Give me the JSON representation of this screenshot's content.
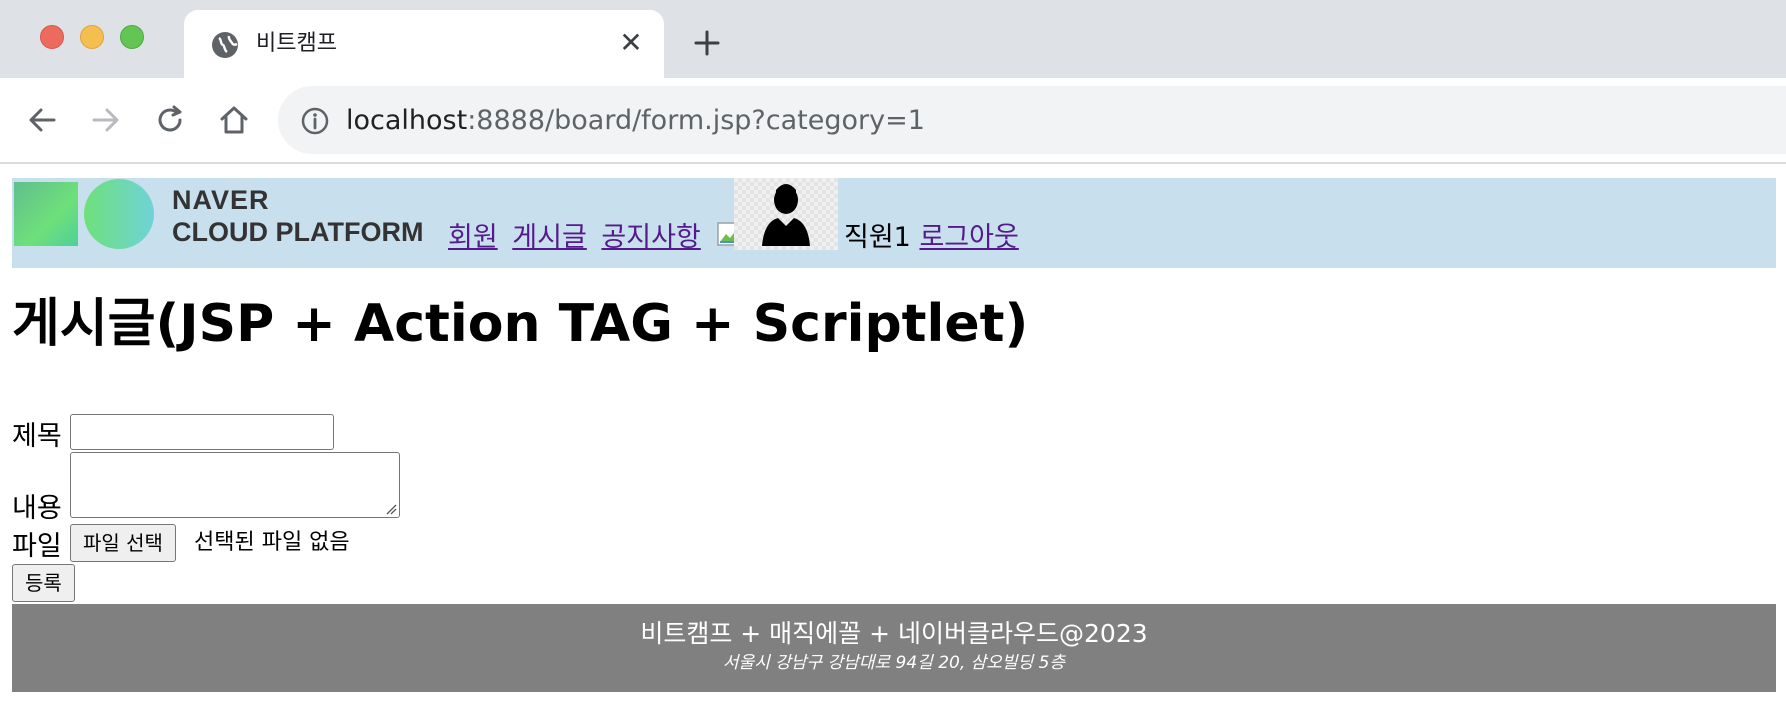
{
  "browser": {
    "tab": {
      "title": "비트캠프",
      "favicon": "globe-icon",
      "close_glyph": "✕"
    },
    "new_tab_icon": "plus-icon",
    "nav": {
      "back_icon": "arrow-left-icon",
      "forward_icon": "arrow-right-icon",
      "reload_icon": "reload-icon",
      "home_icon": "home-icon"
    },
    "address": {
      "host": "localhost",
      "rest": ":8888/board/form.jsp?category=1",
      "info_icon": "info-icon"
    },
    "window_controls": [
      "close",
      "minimize",
      "zoom"
    ]
  },
  "header": {
    "logo": {
      "line1": "NAVER",
      "line2": "CLOUD PLATFORM"
    },
    "links": [
      {
        "label": "회원"
      },
      {
        "label": "게시글"
      },
      {
        "label": "공지사항"
      }
    ],
    "user": {
      "name": "직원1",
      "logout_label": "로그아웃"
    }
  },
  "main": {
    "title": "게시글(JSP + Action TAG + Scriptlet)",
    "form": {
      "title_label": "제목",
      "title_value": "",
      "content_label": "내용",
      "content_value": "",
      "file_label": "파일",
      "file_button_label": "파일 선택",
      "file_status": "선택된 파일 없음",
      "submit_label": "등록"
    }
  },
  "footer": {
    "main": "비트캠프 + 매직에꼴 + 네이버클라우드@2023",
    "address": "서울시 강남구 강남대로 94길 20, 삼오빌딩 5층"
  },
  "colors": {
    "header_bg": "#c8dfee",
    "footer_bg": "#808080",
    "link_visited": "#551a8b",
    "tabstrip_bg": "#dee1e6",
    "omnibox_bg": "#f1f3f4"
  }
}
